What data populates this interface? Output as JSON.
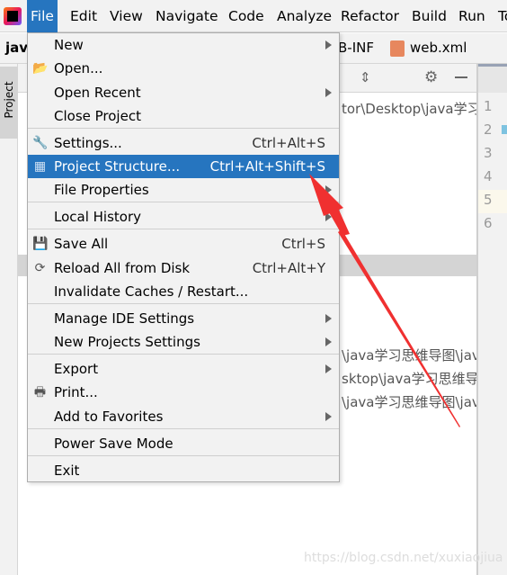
{
  "menubar": {
    "items": [
      "File",
      "Edit",
      "View",
      "Navigate",
      "Code",
      "Analyze",
      "Refactor",
      "Build",
      "Run",
      "To"
    ]
  },
  "navbar": {
    "project": "jav",
    "crumb": "B-INF",
    "file": "web.xml"
  },
  "side": {
    "project_tab": "Project"
  },
  "paths": [
    "tor\\Desktop\\java学习思",
    "\\java学习思维导图\\java",
    "sktop\\java学习思维导图",
    "\\java学习思维导图\\java"
  ],
  "gutter": {
    "lines": [
      "1",
      "2",
      "3",
      "4",
      "5",
      "6"
    ]
  },
  "menu": {
    "items": [
      {
        "label": "New",
        "submenu": true
      },
      {
        "label": "Open...",
        "icon": "folder-open-icon"
      },
      {
        "label": "Open Recent",
        "submenu": true
      },
      {
        "label": "Close Project"
      },
      {
        "label": "Settings...",
        "shortcut": "Ctrl+Alt+S",
        "icon": "wrench-icon"
      },
      {
        "label": "Project Structure...",
        "shortcut": "Ctrl+Alt+Shift+S",
        "icon": "project-structure-icon",
        "highlighted": true
      },
      {
        "label": "File Properties",
        "submenu": true
      },
      {
        "label": "Local History",
        "submenu": true
      },
      {
        "label": "Save All",
        "shortcut": "Ctrl+S",
        "icon": "save-icon"
      },
      {
        "label": "Reload All from Disk",
        "shortcut": "Ctrl+Alt+Y",
        "icon": "reload-icon"
      },
      {
        "label": "Invalidate Caches / Restart..."
      },
      {
        "label": "Manage IDE Settings",
        "submenu": true
      },
      {
        "label": "New Projects Settings",
        "submenu": true
      },
      {
        "label": "Export",
        "submenu": true
      },
      {
        "label": "Print...",
        "icon": "printer-icon"
      },
      {
        "label": "Add to Favorites",
        "submenu": true
      },
      {
        "label": "Power Save Mode"
      },
      {
        "label": "Exit"
      }
    ]
  },
  "watermark": "https://blog.csdn.net/xuxiaojiua",
  "colors": {
    "accent": "#2675bf",
    "arrow": "#f03030"
  }
}
